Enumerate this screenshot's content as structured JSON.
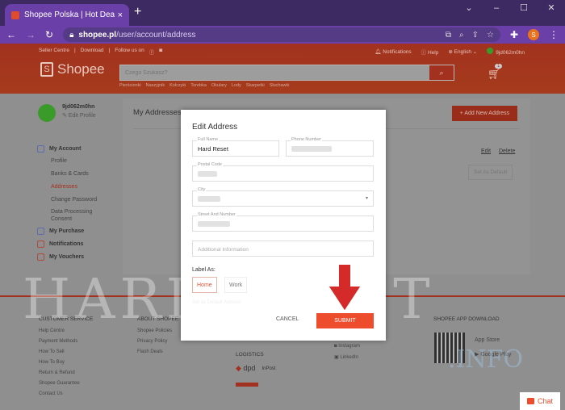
{
  "browser": {
    "tab_title": "Shopee Polska | Hot Deals, Best",
    "url_host": "shopee.pl",
    "url_path": "/user/account/address",
    "profile_initial": "S",
    "new_tab": "+",
    "close": "×"
  },
  "topnav": {
    "seller": "Seller Centre",
    "download": "Download",
    "follow": "Follow us on",
    "notifications": "Notifications",
    "help": "Help",
    "language": "English",
    "username": "9jd062m0hn"
  },
  "header": {
    "logo": "Shopee",
    "search_placeholder": "Czego Szukasz?",
    "cart_count": "1",
    "keywords": [
      "Pierścionki",
      "Naszyjnik",
      "Kolczyki",
      "Torebka",
      "Okulary",
      "Lody",
      "Skarpetki",
      "Słuchawki"
    ]
  },
  "sidebar": {
    "username": "9jd062m0hn",
    "edit_profile": "✎ Edit Profile",
    "my_account": "My Account",
    "sub": [
      "Profile",
      "Banks & Cards",
      "Addresses",
      "Change Password",
      "Data Processing Consent"
    ],
    "my_purchase": "My Purchase",
    "notifications": "Notifications",
    "my_vouchers": "My Vouchers"
  },
  "panel": {
    "title": "My Addresses",
    "add_button": "+ Add New Address",
    "edit": "Edit",
    "delete": "Delete",
    "set_default": "Set As Default"
  },
  "modal": {
    "title": "Edit Address",
    "full_name_label": "Full Name",
    "full_name_value": "Hard Reset",
    "phone_label": "Phone Number",
    "postal_label": "Postal Code",
    "city_label": "City",
    "street_label": "Street And Number",
    "additional_placeholder": "Additional Information",
    "label_as": "Label As:",
    "home": "Home",
    "work": "Work",
    "set_default": "Set as Default Address",
    "cancel": "CANCEL",
    "submit": "SUBMIT"
  },
  "footer": {
    "customer_service": {
      "title": "CUSTOMER SERVICE",
      "links": [
        "Help Centre",
        "Payment Methods",
        "How To Sell",
        "How To Buy",
        "Return & Refund",
        "Shopee Guarantee",
        "Contact Us"
      ]
    },
    "about": {
      "title": "ABOUT SHOPEE",
      "links": [
        "Shopee Policies",
        "Privacy Policy",
        "Flash Deals"
      ]
    },
    "logistics": "LOGISTICS",
    "logistics_brands": [
      "dpd",
      "InPost"
    ],
    "social": [
      "Instagram",
      "LinkedIn"
    ],
    "app_download": "SHOPEE APP DOWNLOAD",
    "stores": [
      "App Store",
      "Google Play"
    ]
  },
  "watermark": {
    "main": "HARDRESET",
    "sub": ".INFO"
  },
  "chat": "Chat"
}
